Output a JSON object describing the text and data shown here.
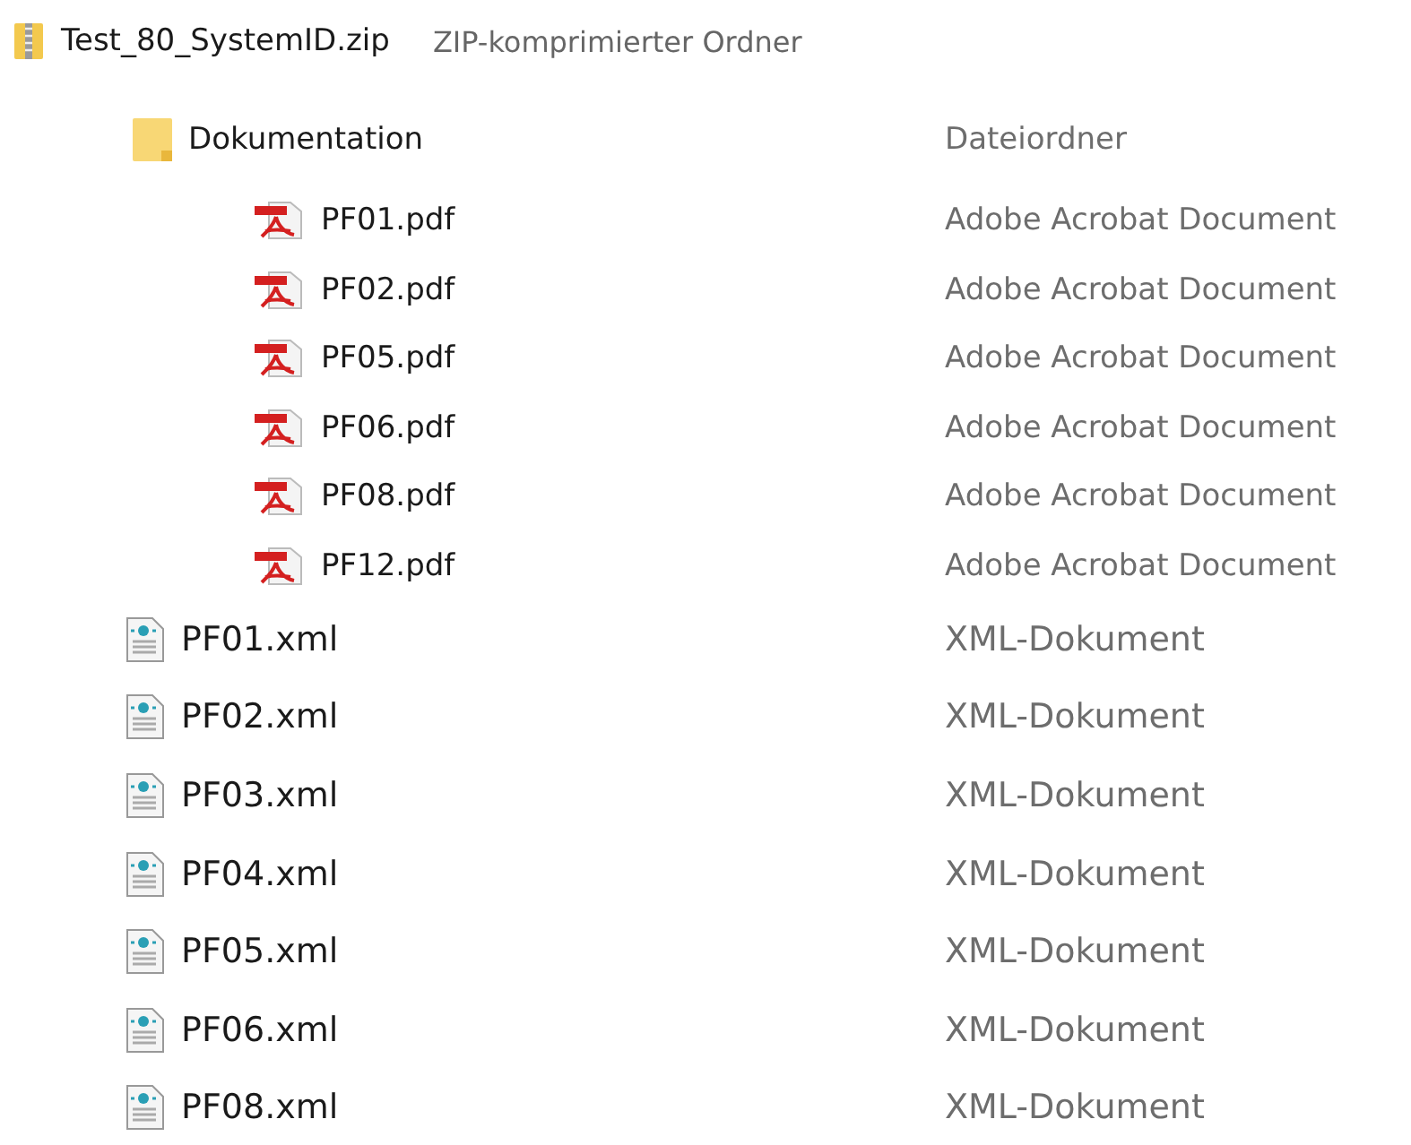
{
  "archive": {
    "name": "Test_80_SystemID.zip",
    "type": "ZIP-komprimierter Ordner",
    "kind": "zip",
    "children": [
      {
        "name": "Dokumentation",
        "type": "Dateiordner",
        "kind": "folder",
        "children": [
          {
            "name": "PF01.pdf",
            "type": "Adobe Acrobat Document",
            "kind": "pdf"
          },
          {
            "name": "PF02.pdf",
            "type": "Adobe Acrobat Document",
            "kind": "pdf"
          },
          {
            "name": "PF05.pdf",
            "type": "Adobe Acrobat Document",
            "kind": "pdf"
          },
          {
            "name": "PF06.pdf",
            "type": "Adobe Acrobat Document",
            "kind": "pdf"
          },
          {
            "name": "PF08.pdf",
            "type": "Adobe Acrobat Document",
            "kind": "pdf"
          },
          {
            "name": "PF12.pdf",
            "type": "Adobe Acrobat Document",
            "kind": "pdf"
          }
        ]
      },
      {
        "name": "PF01.xml",
        "type": "XML-Dokument",
        "kind": "xml"
      },
      {
        "name": "PF02.xml",
        "type": "XML-Dokument",
        "kind": "xml"
      },
      {
        "name": "PF03.xml",
        "type": "XML-Dokument",
        "kind": "xml"
      },
      {
        "name": "PF04.xml",
        "type": "XML-Dokument",
        "kind": "xml"
      },
      {
        "name": "PF05.xml",
        "type": "XML-Dokument",
        "kind": "xml"
      },
      {
        "name": "PF06.xml",
        "type": "XML-Dokument",
        "kind": "xml"
      },
      {
        "name": "PF08.xml",
        "type": "XML-Dokument",
        "kind": "xml"
      }
    ]
  }
}
